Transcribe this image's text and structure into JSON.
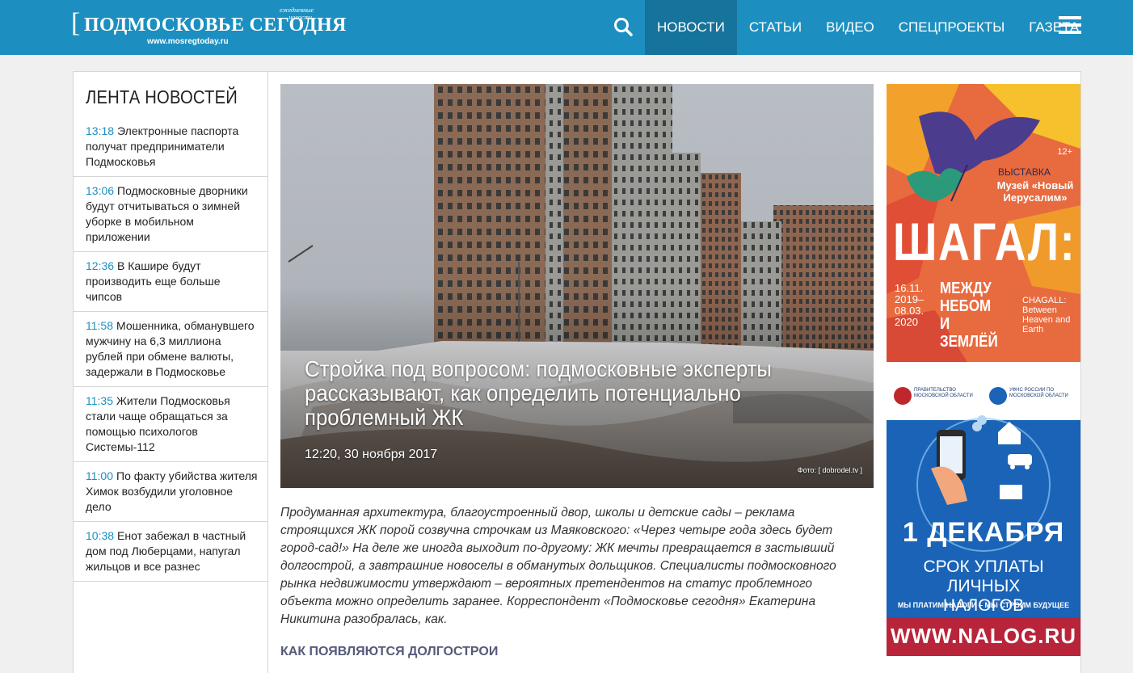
{
  "header": {
    "logo_title": "ПОДМОСКОВЬЕ СЕГОДНЯ",
    "logo_bracket": "[",
    "logo_tagline": "ежедневные новости.",
    "logo_url": "www.mosregtoday.ru",
    "nav": [
      "НОВОСТИ",
      "СТАТЬИ",
      "ВИДЕО",
      "СПЕЦПРОЕКТЫ",
      "ГАЗЕТА"
    ],
    "active_nav": "НОВОСТИ",
    "icons": [
      "search-icon",
      "hamburger-menu-icon"
    ],
    "colors": {
      "header_bg": "#1c8fc0",
      "active_nav_bg": "#16739b"
    }
  },
  "feed": {
    "title": "ЛЕНТА НОВОСТЕЙ",
    "items": [
      {
        "time": "13:18",
        "text": "Электронные паспорта получат предприниматели Подмосковья"
      },
      {
        "time": "13:06",
        "text": "Подмосковные дворники будут отчитываться о зимней уборке в мобильном приложении"
      },
      {
        "time": "12:36",
        "text": "В Кашире будут производить еще больше чипсов"
      },
      {
        "time": "11:58",
        "text": "Мошенника, обманувшего мужчину на 6,3 миллиона рублей при обмене валюты, задержали в Подмосковье"
      },
      {
        "time": "11:35",
        "text": "Жители Подмосковья стали чаще обращаться за помощью психологов Системы-112"
      },
      {
        "time": "11:00",
        "text": "По факту убийства жителя Химок возбудили уголовное дело"
      },
      {
        "time": "10:38",
        "text": "Енот забежал в частный дом под Люберцами, напугал жильцов и все разнес"
      }
    ]
  },
  "article": {
    "title": "Стройка под вопросом: подмосковные эксперты рассказывают, как определить потенциально проблемный ЖК",
    "date": "12:20, 30 ноября 2017",
    "photo_credit": "Фото: [ dobrodel.tv ]",
    "lead": "Продуманная архитектура, благоустроенный двор, школы и детские сады – реклама строящихся ЖК порой созвучна строчкам из Маяковского: «Через четыре года здесь будет город-сад!» На деле же иногда выходит по-другому: ЖК мечты превращается в застывший долгострой, а завтрашние новоселы в обманутых дольщиков. Специалисты подмосковного рынка недвижимости утверждают – вероятных претендентов на статус проблемного объекта можно определить заранее. Корреспондент «Подмосковье сегодня» Екатерина Никитина разобралась, как.",
    "subhead": "КАК ПОЯВЛЯЮТСЯ ДОЛГОСТРОИ"
  },
  "ads": {
    "ad1": {
      "age": "12+",
      "label": "ВЫСТАВКА",
      "museum": "Музей «Новый Иерусалим»",
      "title": "ШАГАЛ:",
      "dates": "16.11. 2019– 08.03. 2020",
      "subtitle": "МЕЖДУ НЕБОМ И ЗЕМЛЁЙ",
      "en": "CHAGALL: Between Heaven and Earth",
      "bg": "#e86a3f"
    },
    "ad2": {
      "org_left": "ПРАВИТЕЛЬСТВО МОСКОВСКОЙ ОБЛАСТИ",
      "org_right": "УФНС РОССИИ ПО МОСКОВСКОЙ ОБЛАСТИ",
      "big": "1 ДЕКАБРЯ",
      "mid": "СРОК УПЛАТЫ ЛИЧНЫХ НАЛОГОВ",
      "slogan": "МЫ ПЛАТИМ НАЛОГИ – МЫ СТРОИМ БУДУЩЕЕ",
      "url": "WWW.NALOG.RU",
      "bg": "#1a63b7"
    }
  }
}
